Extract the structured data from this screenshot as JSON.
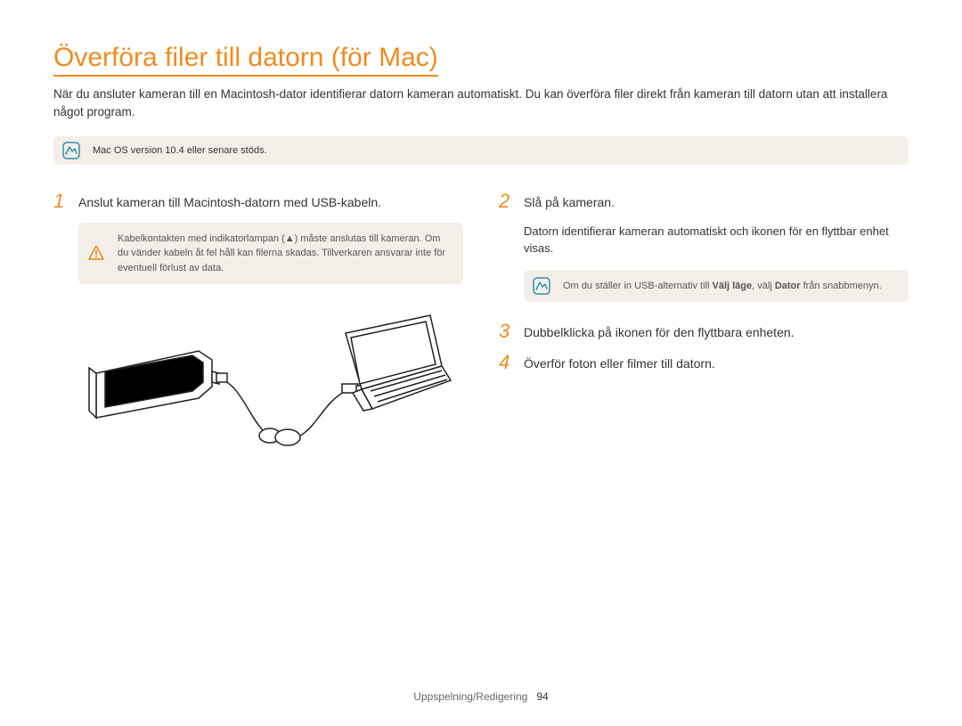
{
  "title": "Överföra filer till datorn (för Mac)",
  "intro": "När du ansluter kameran till en Macintosh-dator identifierar datorn kameran automatiskt. Du kan överföra filer direkt från kameran till datorn utan att installera något program.",
  "topNote": "Mac OS version 10.4 eller senare stöds.",
  "left": {
    "step1": {
      "num": "1",
      "text": "Anslut kameran till Macintosh-datorn med USB-kabeln."
    },
    "warn": "Kabelkontakten med indikatorlampan (▲) måste anslutas till kameran. Om du vänder kabeln åt fel håll kan filerna skadas. Tillverkaren ansvarar inte för eventuell förlust av data."
  },
  "right": {
    "step2": {
      "num": "2",
      "text": "Slå på kameran."
    },
    "step2_sub": "Datorn identifierar kameran automatiskt och ikonen för en flyttbar enhet visas.",
    "tip_pre": "Om du ställer in USB-alternativ till ",
    "tip_b1": "Välj läge",
    "tip_mid": ", välj ",
    "tip_b2": "Dator",
    "tip_post": " från snabbmenyn.",
    "step3": {
      "num": "3",
      "text": "Dubbelklicka på ikonen för den flyttbara enheten."
    },
    "step4": {
      "num": "4",
      "text": "Överför foton eller filmer till datorn."
    }
  },
  "footer": {
    "section": "Uppspelning/Redigering",
    "page": "94"
  }
}
